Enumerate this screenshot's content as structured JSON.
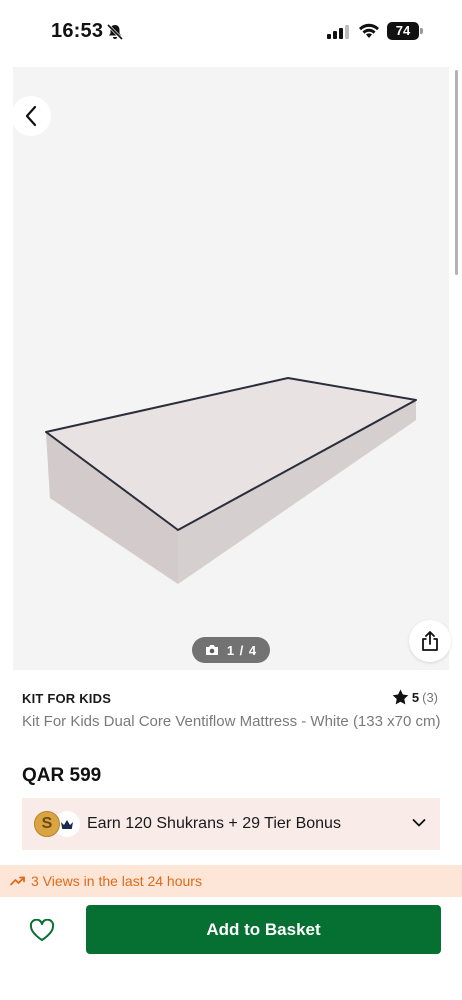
{
  "status_bar": {
    "time": "16:53",
    "battery": "74",
    "icons": [
      "bell-slash-icon",
      "signal-icon",
      "wifi-icon",
      "battery-icon"
    ]
  },
  "gallery": {
    "counter": "1 / 4",
    "icons": [
      "back-arrow-icon",
      "camera-icon",
      "share-icon"
    ]
  },
  "product": {
    "brand": "KIT FOR KIDS",
    "rating": "5",
    "rating_count": "(3)",
    "title": "Kit For Kids Dual Core Ventiflow Mattress - White (133 x70 cm)",
    "price": "QAR 599"
  },
  "shukrans": {
    "coin_letter": "S",
    "text": "Earn 120 Shukrans + 29 Tier Bonus"
  },
  "views_banner": {
    "text": "3 Views in the last 24 hours"
  },
  "actions": {
    "add_to_basket": "Add to Basket"
  },
  "colors": {
    "primary_green": "#067033",
    "banner_orange": "#e06a17",
    "banner_bg": "#fde6d8",
    "shukrans_bg": "#f8ebe8"
  }
}
